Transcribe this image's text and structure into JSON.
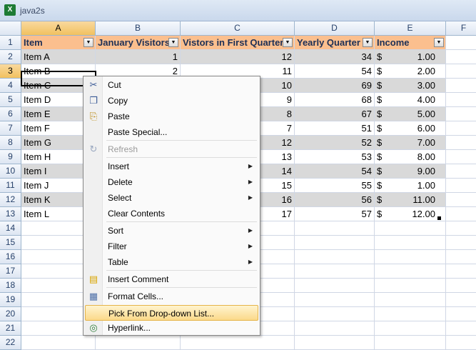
{
  "window": {
    "title": "java2s",
    "icon": "excel-icon"
  },
  "columns": [
    "A",
    "B",
    "C",
    "D",
    "E",
    "F"
  ],
  "rows": [
    "1",
    "2",
    "3",
    "4",
    "5",
    "6",
    "7",
    "8",
    "9",
    "10",
    "11",
    "12",
    "13",
    "14",
    "15",
    "16",
    "17",
    "18",
    "19",
    "20",
    "21",
    "22"
  ],
  "table": {
    "headers": [
      "Item",
      "January Visitors",
      "Vistors in First Quarter",
      "Yearly Quarter",
      "Income"
    ],
    "currency_symbol": "$",
    "data": [
      [
        "Item A",
        "1",
        "12",
        "34",
        "1.00"
      ],
      [
        "Item B",
        "2",
        "11",
        "54",
        "2.00"
      ],
      [
        "Item C",
        "",
        "10",
        "69",
        "3.00"
      ],
      [
        "Item D",
        "",
        "9",
        "68",
        "4.00"
      ],
      [
        "Item E",
        "",
        "8",
        "67",
        "5.00"
      ],
      [
        "Item F",
        "",
        "7",
        "51",
        "6.00"
      ],
      [
        "Item G",
        "",
        "12",
        "52",
        "7.00"
      ],
      [
        "Item H",
        "",
        "13",
        "53",
        "8.00"
      ],
      [
        "Item I",
        "",
        "14",
        "54",
        "9.00"
      ],
      [
        "Item J",
        "",
        "15",
        "55",
        "1.00"
      ],
      [
        "Item K",
        "",
        "16",
        "56",
        "11.00"
      ],
      [
        "Item L",
        "",
        "17",
        "57",
        "12.00"
      ]
    ]
  },
  "selection": {
    "column": "A",
    "row": "3"
  },
  "context_menu": {
    "items": [
      {
        "label": "Cut",
        "icon": "scissors-icon"
      },
      {
        "label": "Copy",
        "icon": "copy-icon"
      },
      {
        "label": "Paste",
        "icon": "paste-icon"
      },
      {
        "label": "Paste Special..."
      },
      {
        "label": "Refresh",
        "icon": "refresh-icon",
        "disabled": true
      },
      {
        "label": "Insert",
        "submenu": true
      },
      {
        "label": "Delete",
        "submenu": true
      },
      {
        "label": "Select",
        "submenu": true
      },
      {
        "label": "Clear Contents"
      },
      {
        "label": "Sort",
        "submenu": true
      },
      {
        "label": "Filter",
        "submenu": true
      },
      {
        "label": "Table",
        "submenu": true
      },
      {
        "label": "Insert Comment",
        "icon": "comment-icon"
      },
      {
        "label": "Format Cells...",
        "icon": "format-cells-icon"
      },
      {
        "label": "Pick From Drop-down List...",
        "highlighted": true
      },
      {
        "label": "Hyperlink...",
        "icon": "hyperlink-icon"
      }
    ]
  },
  "colors": {
    "header_fill": "#fbbf8e",
    "band_fill": "#d9d9d9",
    "menu_highlight": "#fbd98a"
  }
}
